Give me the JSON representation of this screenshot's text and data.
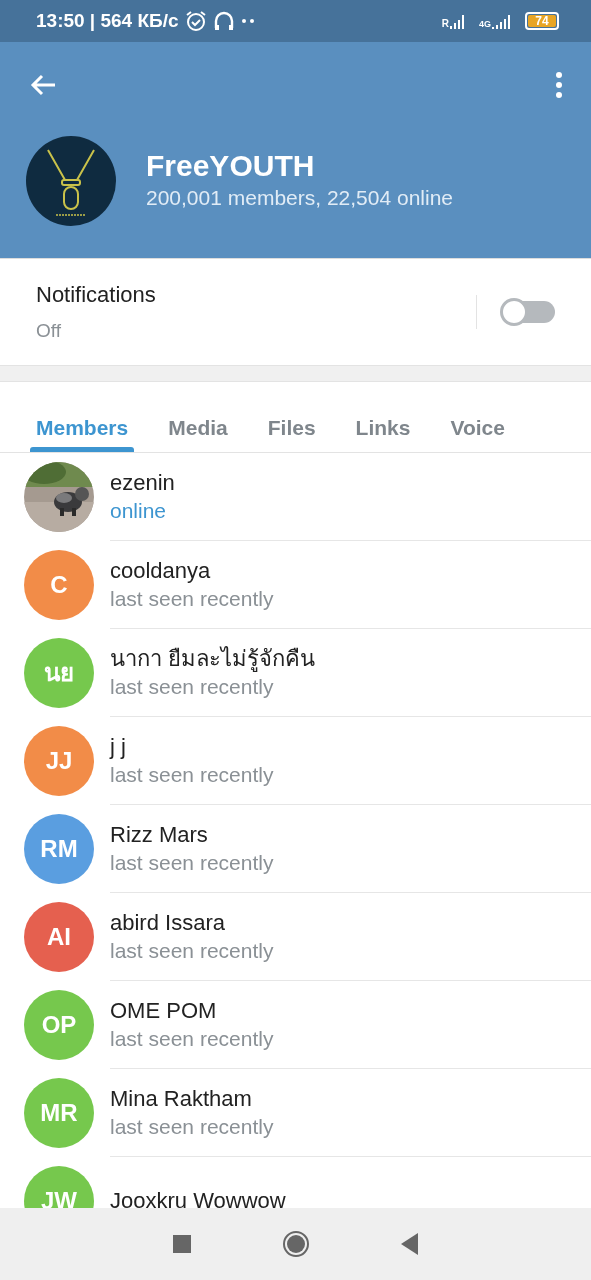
{
  "status_bar": {
    "time": "13:50 | 564 КБ/с",
    "signal_1_label": "R",
    "signal_2_label": "4G",
    "battery": "74"
  },
  "header": {
    "title": "FreeYOUTH",
    "subtitle": "200,001 members, 22,504 online"
  },
  "notifications": {
    "label": "Notifications",
    "value": "Off",
    "on": false
  },
  "tabs": [
    {
      "label": "Members",
      "selected": true
    },
    {
      "label": "Media",
      "selected": false
    },
    {
      "label": "Files",
      "selected": false
    },
    {
      "label": "Links",
      "selected": false
    },
    {
      "label": "Voice",
      "selected": false
    }
  ],
  "members": [
    {
      "name": "ezenin",
      "status": "online",
      "online": true
    },
    {
      "name": "cooldanya",
      "status": "last seen recently",
      "online": false,
      "avatar": {
        "kind": "initials",
        "initials": "C",
        "color": "#f28c48"
      }
    },
    {
      "name": "นากา ยืมละไม่รู้จักคืน",
      "status": "last seen recently",
      "online": false,
      "avatar": {
        "kind": "initials",
        "initials": "นย",
        "color": "#76c84d"
      }
    },
    {
      "name": "j j",
      "status": "last seen recently",
      "online": false,
      "avatar": {
        "kind": "initials",
        "initials": "JJ",
        "color": "#f28c48"
      }
    },
    {
      "name": "Rizz Mars",
      "status": "last seen recently",
      "online": false,
      "avatar": {
        "kind": "initials",
        "initials": "RM",
        "color": "#5a9ee0"
      }
    },
    {
      "name": "abird Issara",
      "status": "last seen recently",
      "online": false,
      "avatar": {
        "kind": "initials",
        "initials": "AI",
        "color": "#e5604f"
      }
    },
    {
      "name": "OME POM",
      "status": "last seen recently",
      "online": false,
      "avatar": {
        "kind": "initials",
        "initials": "OP",
        "color": "#76c84d"
      }
    },
    {
      "name": "Mina Raktham",
      "status": "last seen recently",
      "online": false,
      "avatar": {
        "kind": "initials",
        "initials": "MR",
        "color": "#76c84d"
      }
    },
    {
      "name": "Jooxkru Wowwow",
      "avatar": {
        "kind": "initials",
        "initials": "JW",
        "color": "#76c84d"
      }
    }
  ]
}
